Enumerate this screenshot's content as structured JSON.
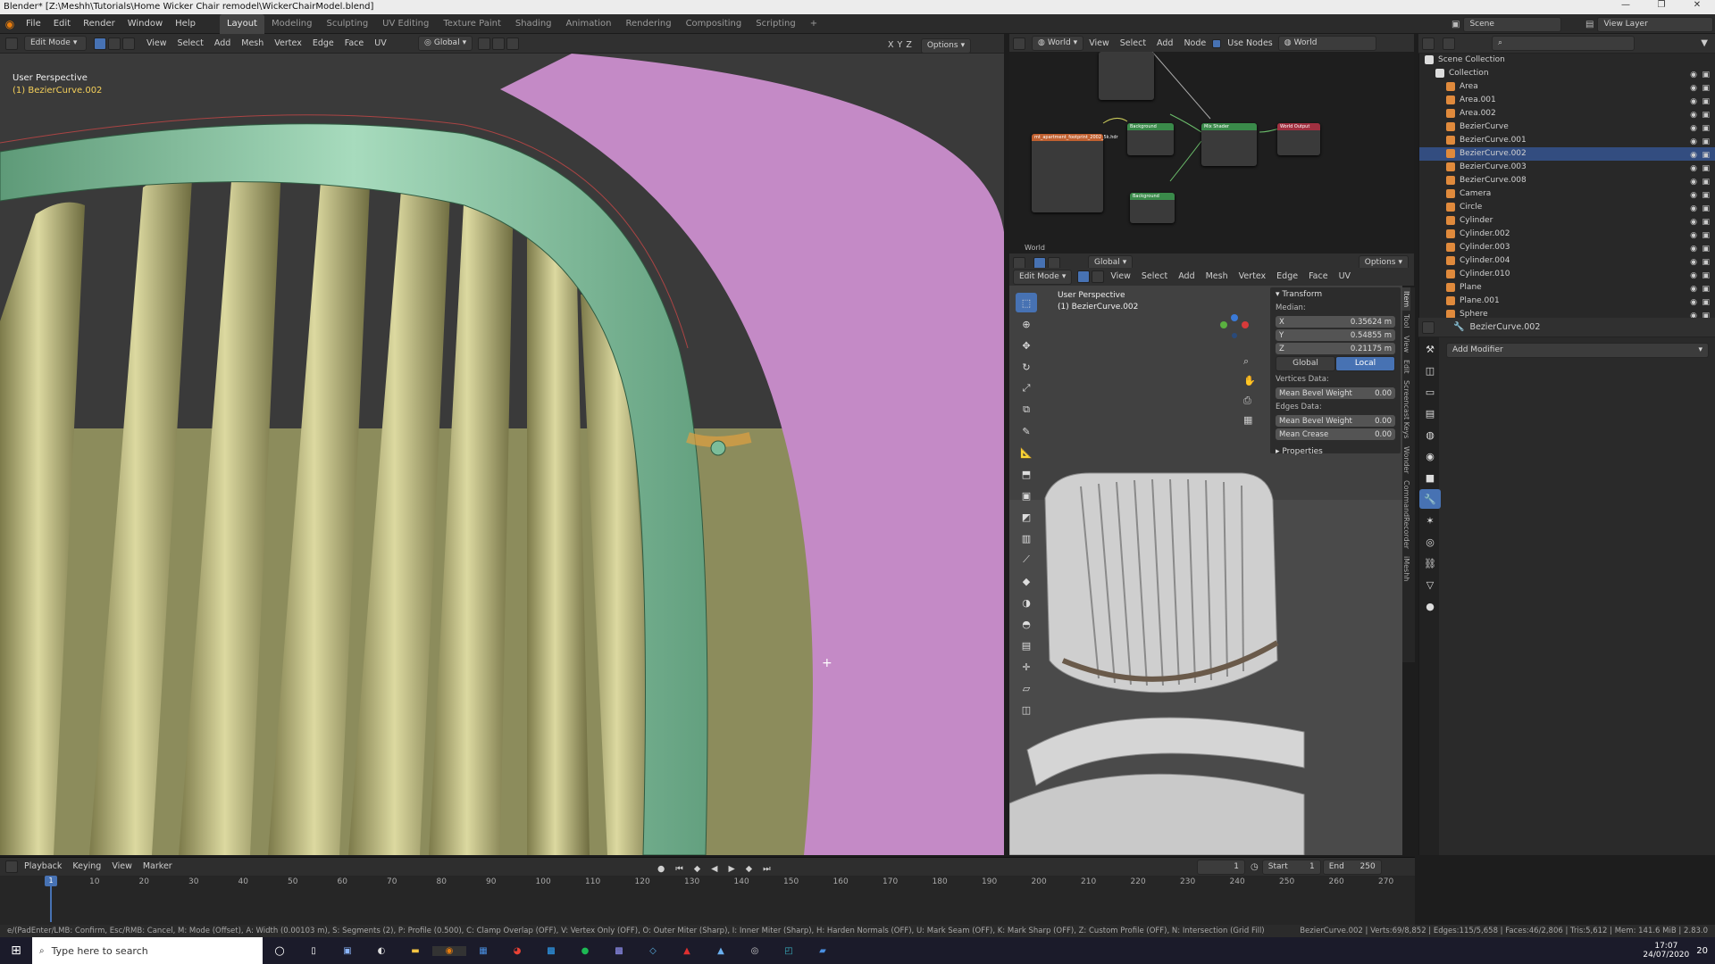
{
  "window": {
    "title": "Blender* [Z:\\Meshh\\Tutorials\\Home Wicker Chair remodel\\WickerChairModel.blend]"
  },
  "topbar": {
    "menus": [
      "File",
      "Edit",
      "Render",
      "Window",
      "Help"
    ],
    "workspaces": [
      "Layout",
      "Modeling",
      "Sculpting",
      "UV Editing",
      "Texture Paint",
      "Shading",
      "Animation",
      "Rendering",
      "Compositing",
      "Scripting"
    ],
    "active_workspace": "Layout",
    "scene": "Scene",
    "view_layer": "View Layer"
  },
  "left_viewport": {
    "mode": "Edit Mode",
    "menus": [
      "View",
      "Select",
      "Add",
      "Mesh",
      "Vertex",
      "Edge",
      "Face",
      "UV"
    ],
    "transform_orientation": "Global",
    "options": "Options",
    "axes": [
      "X",
      "Y",
      "Z"
    ],
    "overlay_title": "User Perspective",
    "overlay_object": "(1) BezierCurve.002"
  },
  "node_editor": {
    "world": "World",
    "menus": [
      "View",
      "Select",
      "Add",
      "Node"
    ],
    "use_nodes": "Use Nodes",
    "world_name": "World",
    "footer": "World",
    "nodes": {
      "env": "mt_apartment_footprint_2002_5k.hdr",
      "bg1": "Background",
      "mix": "Mix Shader",
      "out": "World Output",
      "bg2": "Background"
    }
  },
  "right_viewport": {
    "mode": "Edit Mode",
    "menus": [
      "View",
      "Select",
      "Add",
      "Mesh",
      "Vertex",
      "Edge",
      "Face",
      "UV"
    ],
    "transform_orientation": "Global",
    "options": "Options",
    "overlay_title": "User Perspective",
    "overlay_object": "(1) BezierCurve.002"
  },
  "npanel": {
    "transform": "Transform",
    "median": "Median:",
    "x": {
      "label": "X",
      "value": "0.35624 m"
    },
    "y": {
      "label": "Y",
      "value": "0.54855 m"
    },
    "z": {
      "label": "Z",
      "value": "0.21175 m"
    },
    "global": "Global",
    "local": "Local",
    "vertices_data": "Vertices Data:",
    "mean_bevel_weight_v": {
      "label": "Mean Bevel Weight",
      "value": "0.00"
    },
    "edges_data": "Edges Data:",
    "mean_bevel_weight_e": {
      "label": "Mean Bevel Weight",
      "value": "0.00"
    },
    "mean_crease": {
      "label": "Mean Crease",
      "value": "0.00"
    },
    "properties": "Properties",
    "tabs": [
      "Item",
      "Tool",
      "View",
      "Edit",
      "Screencast Keys",
      "Wonder",
      "CommandRecorder",
      "iMeshh",
      "Extended Tools"
    ]
  },
  "outliner": {
    "root": "Scene Collection",
    "collection": "Collection",
    "items": [
      {
        "name": "Area",
        "color": "#e08a3c"
      },
      {
        "name": "Area.001",
        "color": "#e08a3c"
      },
      {
        "name": "Area.002",
        "color": "#e08a3c"
      },
      {
        "name": "BezierCurve",
        "color": "#e08a3c"
      },
      {
        "name": "BezierCurve.001",
        "color": "#e08a3c"
      },
      {
        "name": "BezierCurve.002",
        "color": "#e08a3c",
        "selected": true
      },
      {
        "name": "BezierCurve.003",
        "color": "#e08a3c"
      },
      {
        "name": "BezierCurve.008",
        "color": "#e08a3c"
      },
      {
        "name": "Camera",
        "color": "#e08a3c"
      },
      {
        "name": "Circle",
        "color": "#e08a3c"
      },
      {
        "name": "Cylinder",
        "color": "#e08a3c"
      },
      {
        "name": "Cylinder.002",
        "color": "#e08a3c"
      },
      {
        "name": "Cylinder.003",
        "color": "#e08a3c"
      },
      {
        "name": "Cylinder.004",
        "color": "#e08a3c"
      },
      {
        "name": "Cylinder.010",
        "color": "#e08a3c"
      },
      {
        "name": "Plane",
        "color": "#e08a3c"
      },
      {
        "name": "Plane.001",
        "color": "#e08a3c"
      },
      {
        "name": "Sphere",
        "color": "#e08a3c"
      }
    ]
  },
  "properties": {
    "object": "BezierCurve.002",
    "add_modifier": "Add Modifier"
  },
  "timeline": {
    "menus": [
      "Playback",
      "Keying",
      "View",
      "Marker"
    ],
    "current_frame": "1",
    "start_label": "Start",
    "start": "1",
    "end_label": "End",
    "end": "250",
    "ticks": [
      "10",
      "20",
      "30",
      "40",
      "50",
      "60",
      "70",
      "80",
      "90",
      "100",
      "110",
      "120",
      "130",
      "140",
      "150",
      "160",
      "170",
      "180",
      "190",
      "200",
      "210",
      "220",
      "230",
      "240",
      "250",
      "260",
      "270"
    ],
    "current_marker": "1"
  },
  "statusbar": {
    "left": "e/(PadEnter/LMB: Confirm, Esc/RMB: Cancel, M: Mode (Offset), A: Width (0.00103 m), S: Segments (2), P: Profile (0.500), C: Clamp Overlap (OFF), V: Vertex Only (OFF), O: Outer Miter (Sharp), I: Inner Miter (Sharp), H: Harden Normals (OFF), U: Mark Seam (OFF), K: Mark Sharp (OFF), Z: Custom Profile (OFF), N: Intersection (Grid Fill)",
    "right": "BezierCurve.002 | Verts:69/8,852 | Edges:115/5,658 | Faces:46/2,806 | Tris:5,612 | Mem: 141.6 MiB | 2.83.0"
  },
  "taskbar": {
    "search_placeholder": "Type here to search",
    "time": "17:07",
    "date": "24/07/2020",
    "notif": "20"
  }
}
